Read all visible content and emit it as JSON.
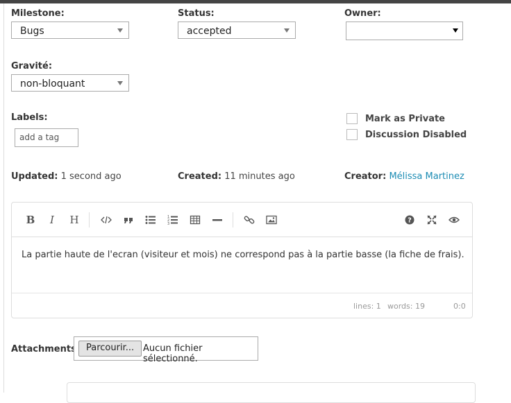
{
  "fields": {
    "milestone": {
      "label": "Milestone:",
      "value": "Bugs"
    },
    "status": {
      "label": "Status:",
      "value": "accepted"
    },
    "owner": {
      "label": "Owner:",
      "value": ""
    },
    "gravite": {
      "label": "Gravité:",
      "value": "non-bloquant"
    },
    "labels": {
      "label": "Labels:",
      "placeholder": "add a tag"
    }
  },
  "checkboxes": {
    "private": {
      "label": "Mark as Private",
      "checked": false
    },
    "discussion": {
      "label": "Discussion Disabled",
      "checked": false
    }
  },
  "meta": {
    "updated_label": "Updated:",
    "updated_value": "1 second ago",
    "created_label": "Created:",
    "created_value": "11 minutes ago",
    "creator_label": "Creator:",
    "creator_value": "Mélissa Martinez"
  },
  "editor": {
    "toolbar": {
      "bold": "B",
      "italic": "I",
      "heading": "H"
    },
    "content": "La partie haute de l'ecran (visiteur et mois) ne correspond pas à la partie basse (la fiche de frais).",
    "status": {
      "lines": "lines: 1",
      "words": "words: 19",
      "cursor": "0:0"
    }
  },
  "attachments": {
    "label": "Attachments:",
    "browse_label": "Parcourir...",
    "no_file": "Aucun fichier sélectionné."
  },
  "colors": {
    "link": "#1a8bb3",
    "topbar": "#444444"
  }
}
